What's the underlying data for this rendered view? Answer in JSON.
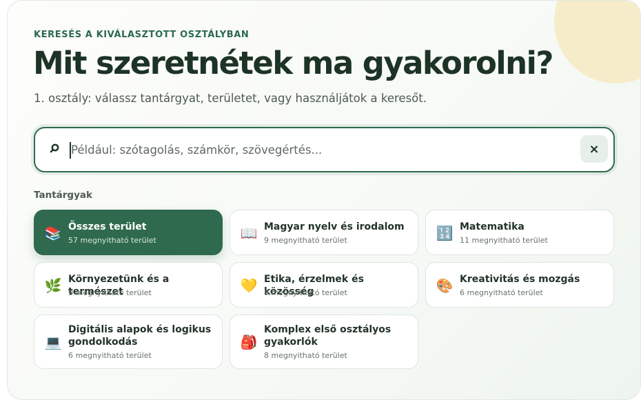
{
  "header": {
    "eyebrow": "KERESÉS A KIVÁLASZTOTT OSZTÁLYBAN",
    "title": "Mit szeretnétek ma gyakorolni?",
    "subtitle": "1. osztály: válassz tantárgyat, területet, vagy használjátok a keresőt."
  },
  "search": {
    "placeholder": "Például: szótagolás, számkör, szövegértés...",
    "value": "",
    "clear_label": "×",
    "icon": "search-icon"
  },
  "subjects_label": "Tantárgyak",
  "subjects": [
    {
      "name": "Összes terület",
      "count": "57 megnyitható terület",
      "icon": "📚",
      "icon_name": "books-icon",
      "active": true
    },
    {
      "name": "Magyar nyelv és irodalom",
      "count": "9 megnyitható terület",
      "icon": "📖",
      "icon_name": "open-book-icon",
      "active": false
    },
    {
      "name": "Matematika",
      "count": "11 megnyitható terület",
      "icon": "🔢",
      "icon_name": "numbers-icon",
      "active": false
    },
    {
      "name": "Környezetünk és a természet",
      "count": "9 megnyitható terület",
      "icon": "🌿",
      "icon_name": "herb-icon",
      "active": false
    },
    {
      "name": "Etika, érzelmek és közösség",
      "count": "8 megnyitható terület",
      "icon": "💛",
      "icon_name": "yellow-heart-icon",
      "active": false
    },
    {
      "name": "Kreativitás és mozgás",
      "count": "6 megnyitható terület",
      "icon": "🎨",
      "icon_name": "palette-icon",
      "active": false
    },
    {
      "name": "Digitális alapok és logikus gondolkodás",
      "count": "6 megnyitható terület",
      "icon": "💻",
      "icon_name": "laptop-icon",
      "active": false
    },
    {
      "name": "Komplex első osztályos gyakorlók",
      "count": "8 megnyitható terület",
      "icon": "🎒",
      "icon_name": "backpack-icon",
      "active": false
    }
  ],
  "colors": {
    "accent": "#2f6a4e",
    "title": "#1d3325",
    "sun": "#f6ecc9"
  }
}
